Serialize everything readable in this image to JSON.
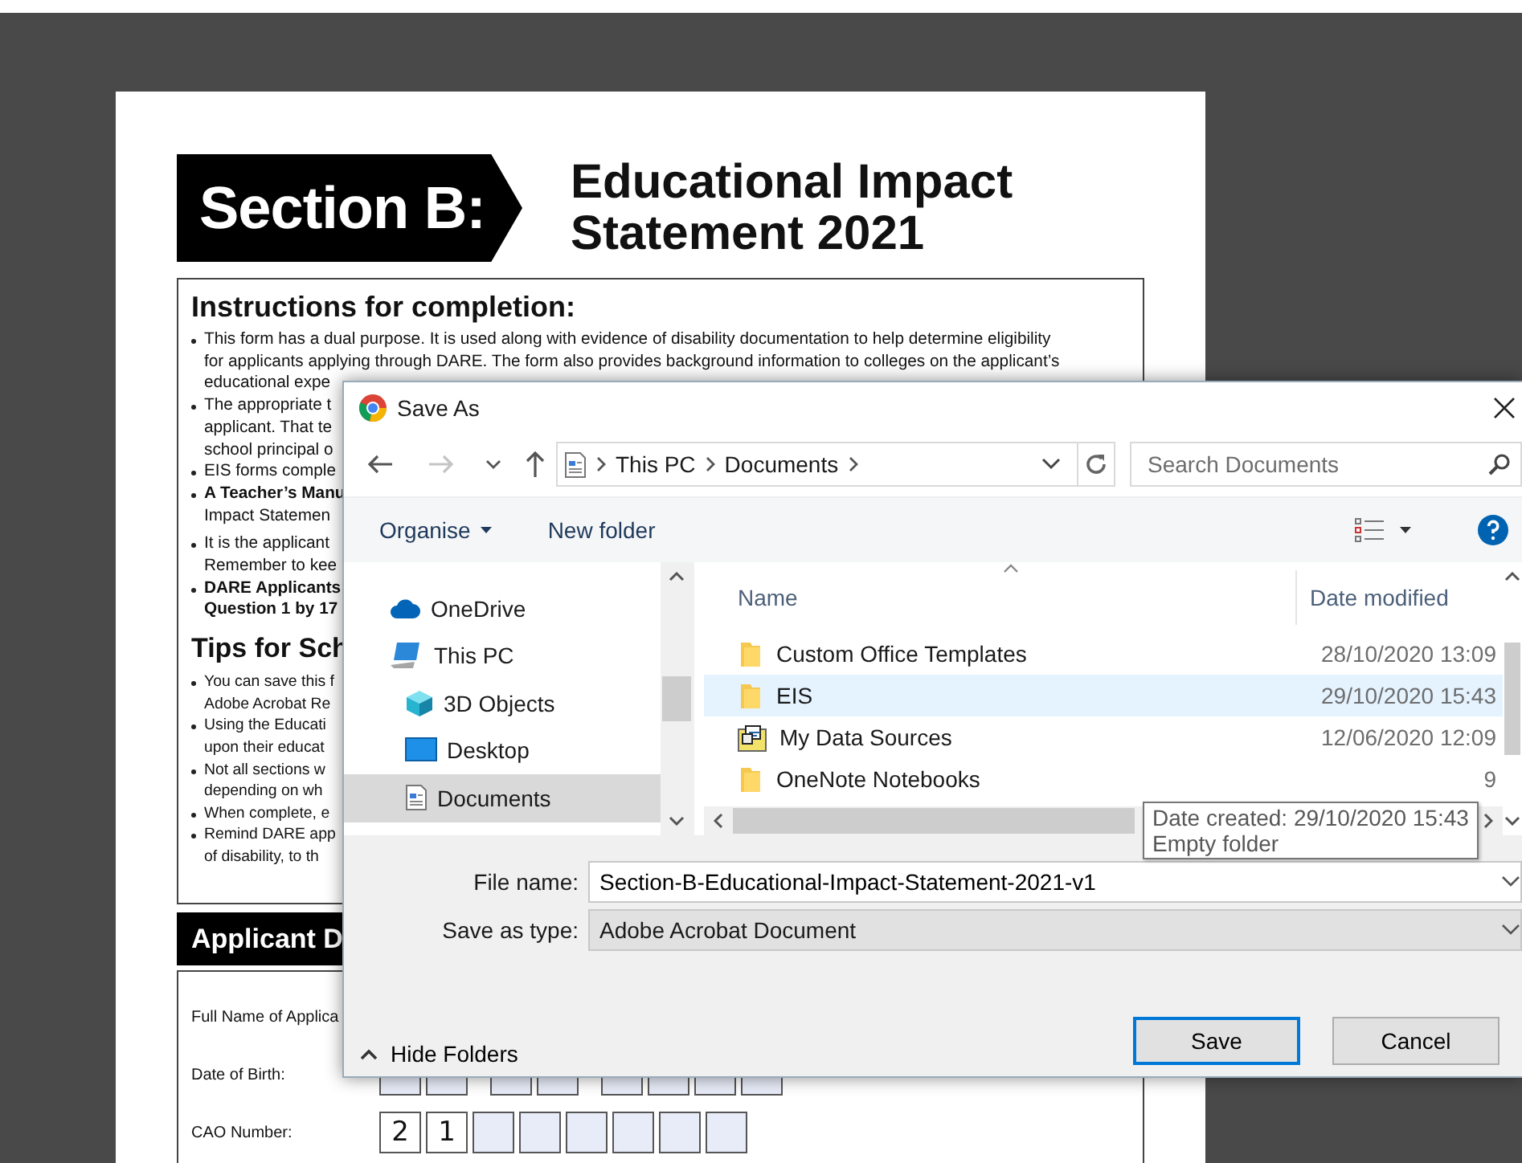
{
  "document": {
    "banner": "Section B:",
    "title_lines": [
      "Educational Impact",
      "Statement 2021"
    ],
    "instructions": {
      "heading": "Instructions for completion:",
      "bullets": [
        {
          "bold": false,
          "lines": [
            "This form has a dual purpose. It is used along with evidence of disability documentation to help determine eligibility",
            "for applicants applying through DARE. The form also provides background information to colleges on the applicant’s",
            "educational expe"
          ]
        },
        {
          "bold": false,
          "lines": [
            "The appropriate t",
            "applicant. That te",
            "school principal o"
          ]
        },
        {
          "bold": false,
          "lines": [
            "EIS forms comple"
          ]
        },
        {
          "bold": false,
          "lines": [
            "**A Teacher’s Manu**",
            "Impact Statemen"
          ]
        },
        {
          "bold": false,
          "lines": [
            "It is the applicant",
            "Remember to kee"
          ]
        },
        {
          "bold": true,
          "lines": [
            "DARE Applicants",
            "Question 1 by 17"
          ]
        }
      ]
    },
    "tips": {
      "heading": "Tips for Sch",
      "bullets": [
        {
          "bold": false,
          "lines": [
            "You can save this f",
            "Adobe Acrobat Re"
          ]
        },
        {
          "bold": false,
          "lines": [
            "Using the Educati",
            "upon their educat"
          ]
        },
        {
          "bold": false,
          "lines": [
            "Not all sections w",
            "depending on wh"
          ]
        },
        {
          "bold": false,
          "lines": [
            "When complete, e"
          ]
        },
        {
          "bold": false,
          "lines": [
            "Remind DARE app",
            "of disability, to th"
          ]
        }
      ]
    },
    "applicant_bar": "Applicant D",
    "fields": [
      {
        "kind": "name",
        "label": "Full Name of Applica"
      },
      {
        "kind": "date",
        "label": "Date of Birth:"
      },
      {
        "kind": "digits",
        "label": "CAO Number:",
        "digits": [
          "2",
          "1"
        ]
      }
    ]
  },
  "dialog": {
    "title": "Save As",
    "nav": {
      "back_disabled": false,
      "forward_disabled": true
    },
    "address": [
      "This PC",
      "Documents"
    ],
    "search": {
      "placeholder": "Search Documents"
    },
    "toolbar": {
      "organise": "Organise",
      "new_folder": "New folder"
    },
    "folders": [
      {
        "label": "OneDrive",
        "kind": "cloud",
        "selected": false,
        "indent": false
      },
      {
        "label": "This PC",
        "kind": "pc",
        "selected": false,
        "indent": false
      },
      {
        "label": "3D Objects",
        "kind": "cube",
        "selected": false,
        "indent": true
      },
      {
        "label": "Desktop",
        "kind": "desktop",
        "selected": false,
        "indent": true
      },
      {
        "label": "Documents",
        "kind": "document",
        "selected": true,
        "indent": true
      }
    ],
    "columns": [
      "Name",
      "Date modified"
    ],
    "files": [
      {
        "name": "Custom Office Templates",
        "kind": "folder",
        "date": "28/10/2020 13:09",
        "selected": false
      },
      {
        "name": "EIS",
        "kind": "folder",
        "date": "29/10/2020 15:43",
        "selected": true
      },
      {
        "name": "My Data Sources",
        "kind": "data",
        "date": "12/06/2020 12:09",
        "selected": false
      },
      {
        "name": "OneNote Notebooks",
        "kind": "folder",
        "date": "9",
        "selected": false
      }
    ],
    "tooltip": [
      "Date created: 29/10/2020 15:43",
      "Empty folder"
    ],
    "file_name_label": "File name:",
    "file_name": "Section-B-Educational-Impact-Statement-2021-v1",
    "type_label": "Save as type:",
    "type": "Adobe Acrobat Document",
    "hide_folders": "Hide Folders",
    "save": "Save",
    "cancel": "Cancel"
  }
}
